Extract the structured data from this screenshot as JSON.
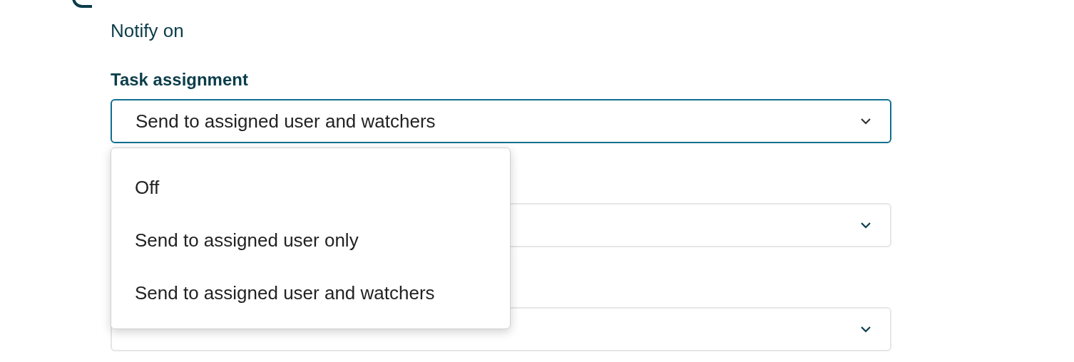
{
  "section": {
    "subtitle": "Notify on"
  },
  "fields": [
    {
      "label": "Task assignment",
      "value": "Send to assigned user and watchers",
      "focused": true,
      "open": true,
      "options": [
        "Off",
        "Send to assigned user only",
        "Send to assigned user and watchers"
      ]
    },
    {
      "focused": false
    },
    {
      "focused": false
    }
  ]
}
